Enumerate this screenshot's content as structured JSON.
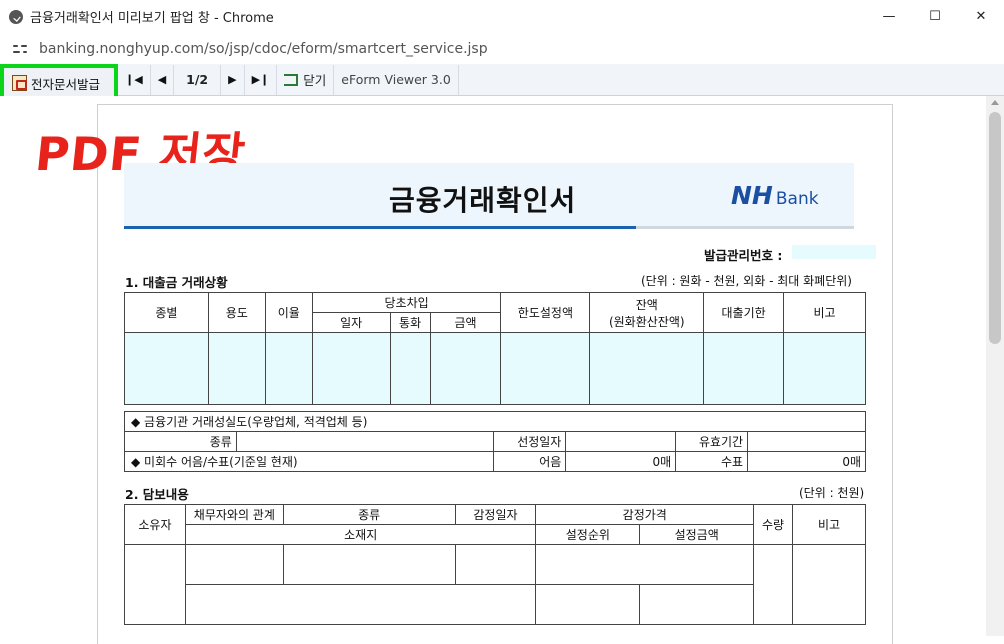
{
  "window": {
    "title": "금융거래확인서 미리보기 팝업 창 - Chrome",
    "minimize": "—",
    "maximize": "☐",
    "close": "✕"
  },
  "address": {
    "url": "banking.nonghyup.com/so/jsp/cdoc/eform/smartcert_service.jsp"
  },
  "viewer_toolbar": {
    "issue_button": "전자문서발급",
    "first": "❙◀",
    "prev": "◀",
    "page_indicator": "1/2",
    "next": "▶",
    "last": "▶❙",
    "close_label": "닫기",
    "viewer_name": "eForm Viewer 3.0"
  },
  "annotation": {
    "pdf_save": "PDF 저장"
  },
  "document": {
    "title": "금융거래확인서",
    "logo_nh": "NH",
    "logo_bank": "Bank",
    "issue_number_label": "발급관리번호 :",
    "issue_number_value": "",
    "section1": {
      "title": "1. 대출금 거래상황",
      "unit": "(단위 : 원화 - 천원, 외화 - 최대 화폐단위)",
      "headers": {
        "type": "종별",
        "purpose": "용도",
        "rate": "이율",
        "initial_borrow": "당초차입",
        "date": "일자",
        "currency": "통화",
        "amount": "금액",
        "limit_amount": "한도설정액",
        "balance": "잔액",
        "balance_sub": "(원화환산잔액)",
        "due_date": "대출기한",
        "remarks": "비고"
      },
      "credit_line": "◆ 금융기관 거래성실도(우량업체, 적격업체 등)",
      "kind_label": "종류",
      "selection_date_label": "선정일자",
      "validity_label": "유효기간",
      "unpaid_line": "◆ 미회수 어음/수표(기준일 현재)",
      "bill_label": "어음",
      "bill_count": "0매",
      "check_label": "수표",
      "check_count": "0매"
    },
    "section2": {
      "title": "2. 담보내용",
      "unit": "(단위 : 천원)",
      "headers": {
        "owner": "소유자",
        "relation": "채무자와의 관계",
        "kind": "종류",
        "appraisal_date": "감정일자",
        "appraisal_price": "감정가격",
        "quantity": "수량",
        "remarks": "비고",
        "location": "소재지",
        "priority": "설정순위",
        "setting_amount": "설정금액"
      }
    }
  },
  "colors": {
    "highlight_green": "#0bd41b",
    "annotation_red": "#e8231b",
    "nh_blue": "#1a4fa1",
    "empty_cell_cyan": "#e6fbfd"
  }
}
